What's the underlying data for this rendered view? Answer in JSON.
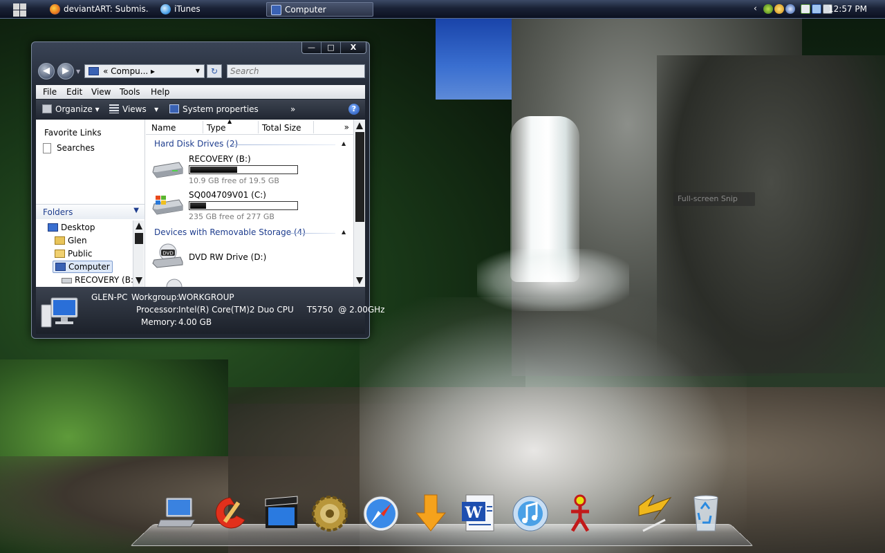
{
  "taskbar": {
    "tasks": [
      {
        "label": "deviantART: Submis...",
        "icon": "firefox-icon",
        "color": "#e8731c"
      },
      {
        "label": "iTunes",
        "icon": "itunes-icon",
        "color": "#4aa0e6"
      },
      {
        "label": "Computer",
        "icon": "computer-icon",
        "color": "#3a62b4"
      }
    ],
    "clock": "12:57 PM"
  },
  "desktop": {
    "snip_tooltip": "Full-screen Snip"
  },
  "window": {
    "controls": {
      "minimize": "—",
      "maximize": "□",
      "close": "X"
    },
    "back": "◀",
    "forward": "▶",
    "address": "«  Compu...  ▸",
    "refresh": "↻",
    "search_placeholder": "Search",
    "menu": [
      "File",
      "Edit",
      "View",
      "Tools",
      "Help"
    ],
    "commands": {
      "organize": "Organize",
      "views": "Views",
      "system_properties": "System properties",
      "more": "»",
      "help": "?"
    },
    "nav": {
      "favorite_links": "Favorite Links",
      "searches": "Searches",
      "folders": "Folders",
      "tree": [
        "Desktop",
        "Glen",
        "Public",
        "Computer",
        "RECOVERY  (B:"
      ]
    },
    "columns": {
      "name": "Name",
      "type": "Type",
      "total_size": "Total Size",
      "more": "»"
    },
    "groups": {
      "hard_disks": "Hard Disk Drives (2)",
      "removable": "Devices with Removable Storage (4)"
    },
    "drives": [
      {
        "name": "RECOVERY  (B:)",
        "free": "10.9 GB free of 19.5 GB",
        "used_fraction": 0.44
      },
      {
        "name": "SQ004709V01 (C:)",
        "free": "235 GB free of 277 GB",
        "used_fraction": 0.15
      },
      {
        "name": "DVD RW Drive (D:)",
        "dvd_label": "DVD"
      }
    ],
    "details": {
      "computer_name": "GLEN-PC",
      "workgroup_label": "Workgroup:",
      "workgroup": "WORKGROUP",
      "processor_label": "Processor:",
      "processor": "Intel(R) Core(TM)2 Duo CPU     T5750  @ 2.00GHz",
      "memory_label": "Memory:",
      "memory": "4.00 GB"
    }
  },
  "dock": [
    {
      "name": "laptop-icon"
    },
    {
      "name": "ccleaner-icon"
    },
    {
      "name": "movie-maker-icon"
    },
    {
      "name": "settings-gear-icon"
    },
    {
      "name": "safari-icon"
    },
    {
      "name": "download-arrow-icon"
    },
    {
      "name": "word-icon",
      "label": "W"
    },
    {
      "name": "itunes-icon"
    },
    {
      "name": "aim-icon"
    },
    {
      "name": "winamp-icon"
    },
    {
      "name": "recycle-bin-icon"
    }
  ]
}
